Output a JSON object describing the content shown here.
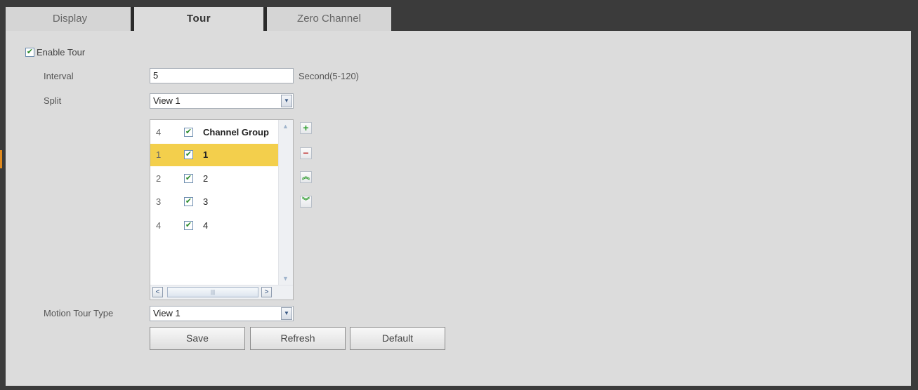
{
  "tabs": [
    {
      "label": "Display"
    },
    {
      "label": "Tour"
    },
    {
      "label": "Zero Channel"
    }
  ],
  "form": {
    "enable_tour_label": "Enable Tour",
    "enable_tour_checked": true,
    "interval_label": "Interval",
    "interval_value": "5",
    "interval_hint": "Second(5-120)",
    "split_label": "Split",
    "split_value": "View 1",
    "motion_tour_label": "Motion Tour Type",
    "motion_tour_value": "View 1"
  },
  "tour_list": {
    "header": {
      "num": "4",
      "label": "Channel Group",
      "checked": true
    },
    "rows": [
      {
        "num": "1",
        "label": "1",
        "checked": true,
        "selected": true
      },
      {
        "num": "2",
        "label": "2",
        "checked": true,
        "selected": false
      },
      {
        "num": "3",
        "label": "3",
        "checked": true,
        "selected": false
      },
      {
        "num": "4",
        "label": "4",
        "checked": true,
        "selected": false
      }
    ]
  },
  "side_buttons": {
    "add": "+",
    "remove": "−",
    "move_up": "≈",
    "move_down": "≈"
  },
  "actions": {
    "save": "Save",
    "refresh": "Refresh",
    "default": "Default"
  },
  "colors": {
    "selected_row": "#f3cf4c",
    "add_green": "#2e9e2e",
    "remove_red": "#c23a3a",
    "arrow_green": "#3aa03a"
  },
  "icons": {
    "checkmark": "✔",
    "scroll_left": "<",
    "scroll_right": ">",
    "dropdown": "chevron-down-icon"
  }
}
